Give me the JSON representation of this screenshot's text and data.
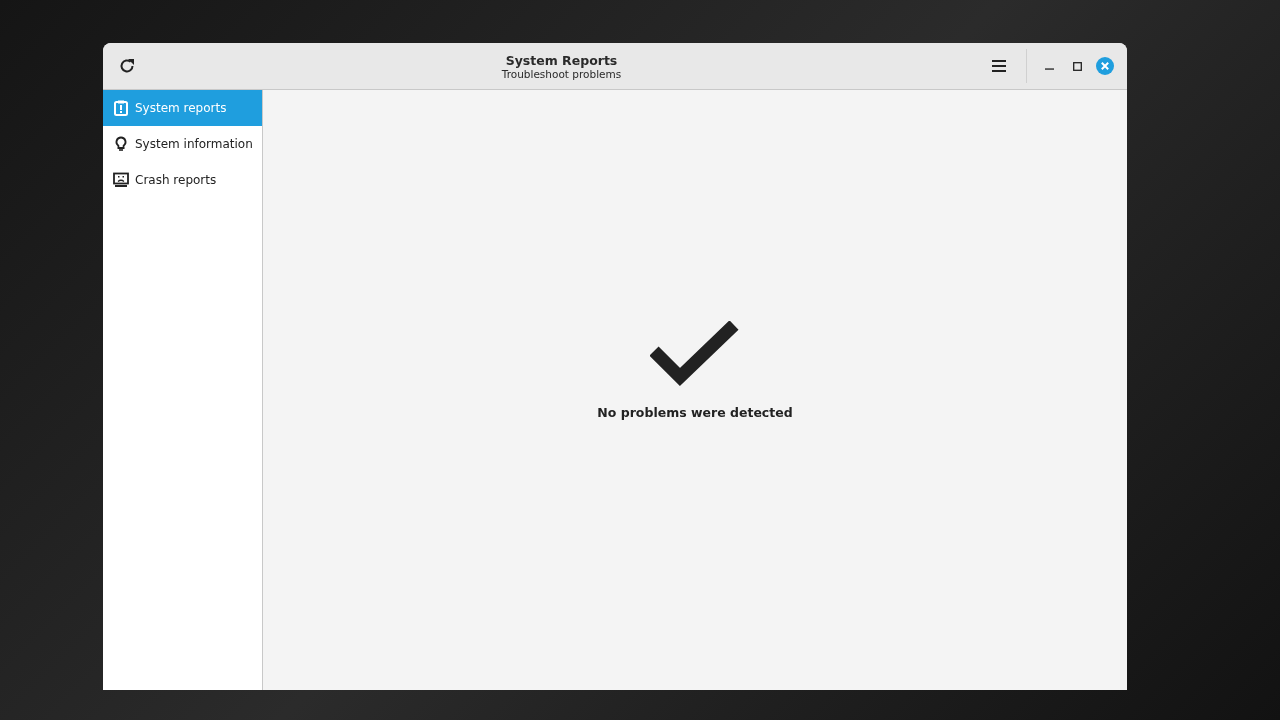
{
  "window": {
    "title": "System Reports",
    "subtitle": "Troubleshoot problems"
  },
  "sidebar": {
    "items": [
      {
        "kind": "reports",
        "label": "System reports",
        "selected": true
      },
      {
        "kind": "information",
        "label": "System information",
        "selected": false
      },
      {
        "kind": "crash",
        "label": "Crash reports",
        "selected": false
      }
    ]
  },
  "status": {
    "message": "No problems were detected"
  }
}
